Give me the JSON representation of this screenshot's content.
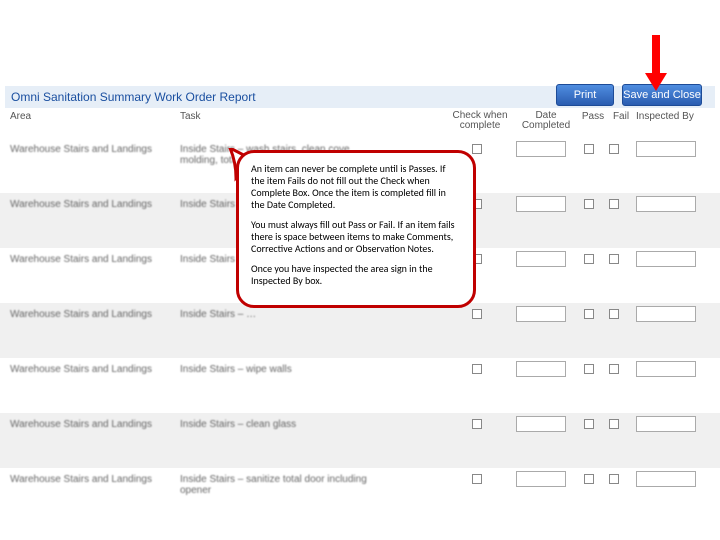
{
  "report_title": "Omni Sanitation Summary Work Order Report",
  "buttons": {
    "print": "Print",
    "save": "Save and Close"
  },
  "columns": {
    "area": "Area",
    "task": "Task",
    "check_l1": "Check when",
    "check_l2": "complete",
    "date_l1": "Date",
    "date_l2": "Completed",
    "pass": "Pass",
    "fail": "Fail",
    "inspected": "Inspected By"
  },
  "rows": [
    {
      "area": "Warehouse Stairs and Landings",
      "task": "Inside Stairs – wash stairs, clean cove molding, total railing wipe…"
    },
    {
      "area": "Warehouse Stairs and Landings",
      "task": "Inside Stairs – …"
    },
    {
      "area": "Warehouse Stairs and Landings",
      "task": "Inside Stairs – …"
    },
    {
      "area": "Warehouse Stairs and Landings",
      "task": "Inside Stairs – …"
    },
    {
      "area": "Warehouse Stairs and Landings",
      "task": "Inside Stairs – wipe walls"
    },
    {
      "area": "Warehouse Stairs and Landings",
      "task": "Inside Stairs – clean glass"
    },
    {
      "area": "Warehouse Stairs and Landings",
      "task": "Inside Stairs – sanitize total door including opener"
    }
  ],
  "callout": {
    "p1": "An item can never be complete until is Passes. If the item Fails do not fill out the Check when Complete Box. Once the item is completed fill in the Date Completed.",
    "p2": "You must always fill out Pass or Fail. If an item fails there is space between items to make Comments, Corrective Actions and or Observation Notes.",
    "p3": "Once you have inspected the area sign in the Inspected By box."
  }
}
